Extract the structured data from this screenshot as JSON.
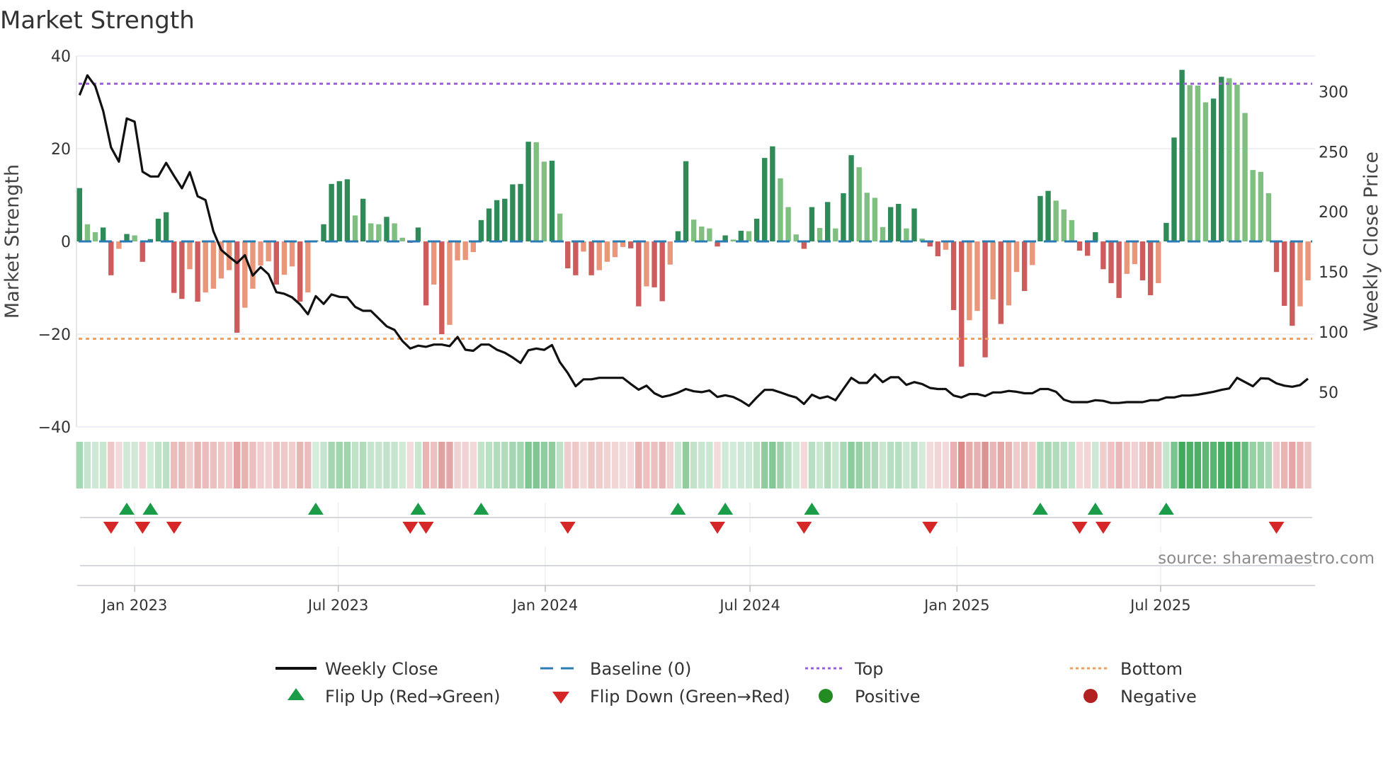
{
  "title": "Market Strength",
  "source": "source: sharemaestro.com",
  "colors": {
    "bar_pos_rising": "#2e8b57",
    "bar_pos_falling": "#7fbf7f",
    "bar_neg_falling": "#cd5c5c",
    "bar_neg_rising": "#e9967a",
    "weekly_close": "#111111",
    "baseline": "#2b7bb4",
    "top": "#9b5fe0",
    "bottom": "#f0a060",
    "flip_up": "#1a9c48",
    "flip_down": "#d62728",
    "positive": "#228b22",
    "negative": "#b22222",
    "strip_green": "#2ca04a",
    "strip_red": "#cd5c5c"
  },
  "legend": [
    {
      "label": "Weekly Close",
      "symbol": "solid-line"
    },
    {
      "label": "Baseline (0)",
      "symbol": "dashed-line"
    },
    {
      "label": "Top",
      "symbol": "dotted-line-purple"
    },
    {
      "label": "Bottom",
      "symbol": "dotted-line-orange"
    },
    {
      "label": "Flip Up (Red→Green)",
      "symbol": "triangle-up"
    },
    {
      "label": "Flip Down (Green→Red)",
      "symbol": "triangle-down"
    },
    {
      "label": "Positive",
      "symbol": "circle-green"
    },
    {
      "label": "Negative",
      "symbol": "circle-red"
    }
  ],
  "chart_data": {
    "type": "bar",
    "title": "Market Strength",
    "ylabel_left": "Market Strength",
    "ylabel_right": "Weekly Close Price",
    "ylim_left": [
      -40,
      40
    ],
    "yticks_left": [
      {
        "value": 40,
        "label": "40"
      },
      {
        "value": 20,
        "label": "20"
      },
      {
        "value": 0,
        "label": "0"
      },
      {
        "value": -20,
        "label": "−20"
      },
      {
        "value": -40,
        "label": "−40"
      }
    ],
    "ylim_right": [
      21.1,
      329.7
    ],
    "yticks_right": [
      {
        "value": 50,
        "label": "50"
      },
      {
        "value": 100,
        "label": "100"
      },
      {
        "value": 150,
        "label": "150"
      },
      {
        "value": 200,
        "label": "200"
      },
      {
        "value": 250,
        "label": "250"
      },
      {
        "value": 300,
        "label": "300"
      }
    ],
    "xticks": [
      {
        "date": "2023-01-01",
        "label": "Jan 2023"
      },
      {
        "date": "2023-07-01",
        "label": "Jul 2023"
      },
      {
        "date": "2024-01-01",
        "label": "Jan 2024"
      },
      {
        "date": "2024-07-01",
        "label": "Jul 2024"
      },
      {
        "date": "2025-01-01",
        "label": "Jan 2025"
      },
      {
        "date": "2025-07-01",
        "label": "Jul 2025"
      }
    ],
    "top": 34,
    "bottom": -21,
    "baseline": 0,
    "grid": true,
    "legend_position": "bottom",
    "dates": [
      "2022-11-13",
      "2022-11-20",
      "2022-11-27",
      "2022-12-04",
      "2022-12-11",
      "2022-12-18",
      "2022-12-25",
      "2023-01-01",
      "2023-01-08",
      "2023-01-15",
      "2023-01-22",
      "2023-01-29",
      "2023-02-05",
      "2023-02-12",
      "2023-02-19",
      "2023-02-26",
      "2023-03-05",
      "2023-03-12",
      "2023-03-19",
      "2023-03-26",
      "2023-04-02",
      "2023-04-09",
      "2023-04-16",
      "2023-04-23",
      "2023-04-30",
      "2023-05-07",
      "2023-05-14",
      "2023-05-21",
      "2023-05-28",
      "2023-06-04",
      "2023-06-11",
      "2023-06-18",
      "2023-06-25",
      "2023-07-02",
      "2023-07-09",
      "2023-07-16",
      "2023-07-23",
      "2023-07-30",
      "2023-08-06",
      "2023-08-13",
      "2023-08-20",
      "2023-08-27",
      "2023-09-03",
      "2023-09-10",
      "2023-09-17",
      "2023-09-24",
      "2023-10-01",
      "2023-10-08",
      "2023-10-15",
      "2023-10-22",
      "2023-10-29",
      "2023-11-05",
      "2023-11-12",
      "2023-11-19",
      "2023-11-26",
      "2023-12-03",
      "2023-12-10",
      "2023-12-17",
      "2023-12-24",
      "2023-12-31",
      "2024-01-07",
      "2024-01-14",
      "2024-01-21",
      "2024-01-28",
      "2024-02-04",
      "2024-02-11",
      "2024-02-18",
      "2024-02-25",
      "2024-03-03",
      "2024-03-10",
      "2024-03-17",
      "2024-03-24",
      "2024-03-31",
      "2024-04-07",
      "2024-04-14",
      "2024-04-21",
      "2024-04-28",
      "2024-05-05",
      "2024-05-12",
      "2024-05-19",
      "2024-05-26",
      "2024-06-02",
      "2024-06-09",
      "2024-06-16",
      "2024-06-23",
      "2024-06-30",
      "2024-07-07",
      "2024-07-14",
      "2024-07-21",
      "2024-07-28",
      "2024-08-04",
      "2024-08-11",
      "2024-08-18",
      "2024-08-25",
      "2024-09-01",
      "2024-09-08",
      "2024-09-15",
      "2024-09-22",
      "2024-09-29",
      "2024-10-06",
      "2024-10-13",
      "2024-10-20",
      "2024-10-27",
      "2024-11-03",
      "2024-11-10",
      "2024-11-17",
      "2024-11-24",
      "2024-12-01",
      "2024-12-08",
      "2024-12-15",
      "2024-12-22",
      "2024-12-29",
      "2025-01-05",
      "2025-01-12",
      "2025-01-19",
      "2025-01-26",
      "2025-02-02",
      "2025-02-09",
      "2025-02-16",
      "2025-02-23",
      "2025-03-02",
      "2025-03-09",
      "2025-03-16",
      "2025-03-23",
      "2025-03-30",
      "2025-04-06",
      "2025-04-13",
      "2025-04-20",
      "2025-04-27",
      "2025-05-04",
      "2025-05-11",
      "2025-05-18",
      "2025-05-25",
      "2025-06-01",
      "2025-06-08",
      "2025-06-15",
      "2025-06-22",
      "2025-06-29",
      "2025-07-06",
      "2025-07-13",
      "2025-07-20",
      "2025-07-27",
      "2025-08-03",
      "2025-08-10",
      "2025-08-17",
      "2025-08-24",
      "2025-08-31",
      "2025-09-07",
      "2025-09-14",
      "2025-09-21",
      "2025-09-28",
      "2025-10-05",
      "2025-10-12",
      "2025-10-19",
      "2025-10-26",
      "2025-11-02",
      "2025-11-09"
    ],
    "strength": [
      11.5,
      3.7,
      2,
      3,
      -7.3,
      -1.6,
      1.6,
      1.3,
      -4.4,
      0.5,
      4.9,
      6.3,
      -11.1,
      -12.4,
      -6,
      -13,
      -11,
      -10.2,
      -8,
      -6.2,
      -19.7,
      -14.3,
      -10.2,
      -5.2,
      -4.3,
      -9.3,
      -7.2,
      -5.4,
      -13,
      -11,
      0.2,
      3.7,
      12.4,
      13,
      13.4,
      5.6,
      9.2,
      3.9,
      3.7,
      5.3,
      3.9,
      0.8,
      -0.3,
      3,
      -13.8,
      -9.3,
      -20,
      -18,
      -4.1,
      -4.0,
      -2.3,
      4.6,
      7.1,
      8.9,
      9.2,
      12.3,
      12.4,
      21.5,
      21.4,
      17.2,
      17.4,
      6,
      -5.8,
      -7.3,
      -2.2,
      -7.3,
      -6.2,
      -4.4,
      -3.4,
      -1.2,
      -1.5,
      -14,
      -9.7,
      -9.9,
      -12.9,
      -5,
      2.2,
      17.3,
      4.7,
      3.2,
      2.8,
      -1.1,
      1.3,
      0.4,
      2.3,
      2.2,
      4.9,
      18,
      20.5,
      13.6,
      7.4,
      1.5,
      -1.6,
      7.4,
      2.9,
      8.5,
      2.8,
      10.4,
      18.6,
      16,
      10.5,
      9.4,
      3.1,
      7.4,
      8.1,
      2.8,
      7.1,
      0.6,
      -1.1,
      -3.2,
      -1.8,
      -14.8,
      -27,
      -17,
      -15,
      -25,
      -12.5,
      -17.8,
      -13.8,
      -6.6,
      -10.7,
      -5.1,
      9.8,
      10.9,
      8.8,
      6.9,
      4.6,
      -2,
      -3.1,
      2,
      -6,
      -9,
      -12.2,
      -7,
      -4.9,
      -8.4,
      -11.6,
      -9,
      4,
      22.4,
      37,
      33.7,
      33.6,
      30,
      30.8,
      35.5,
      35.2,
      33.8,
      27.7,
      15.4,
      15,
      10.4,
      -6.6,
      -13.9,
      -18.2,
      -14,
      -8.4
    ],
    "weekly_close": [
      297,
      313.5,
      304.6,
      284,
      253.6,
      241.8,
      277.7,
      275,
      233.4,
      229.4,
      229.4,
      240.8,
      230,
      219.6,
      233,
      213,
      209.8,
      183.9,
      168.2,
      162.7,
      157.4,
      163.9,
      147,
      154,
      148,
      133.2,
      131.9,
      128.9,
      123,
      114.8,
      129.9,
      123.4,
      131.3,
      129.3,
      128.9,
      121,
      117.7,
      117.7,
      111.2,
      104.8,
      101.8,
      92.6,
      86.3,
      88.7,
      87.7,
      89.6,
      89.6,
      88.3,
      95.9,
      85.3,
      84.4,
      89.6,
      89.6,
      85.3,
      82.8,
      78.9,
      74.3,
      84.8,
      86.3,
      85.2,
      89.2,
      74.9,
      66,
      54.9,
      60.7,
      60.7,
      61.9,
      61.9,
      61.9,
      61.9,
      56.8,
      52.1,
      55.4,
      49.1,
      46,
      47.4,
      49.6,
      52.6,
      50.7,
      50,
      51.4,
      46,
      47.4,
      46,
      42.8,
      38.6,
      45.6,
      51.9,
      51.9,
      49.8,
      47.4,
      45.6,
      40.2,
      47.9,
      44.9,
      46.5,
      43.3,
      52.6,
      61.9,
      57.7,
      57.7,
      64.7,
      58.4,
      62.4,
      62.4,
      56.1,
      58.4,
      56.8,
      53.5,
      52.6,
      52.6,
      47.2,
      45.6,
      48.4,
      48.4,
      46.8,
      49.8,
      49.8,
      51,
      50.3,
      49.1,
      49.1,
      52.6,
      52.6,
      50.3,
      43.8,
      41.7,
      41.7,
      41.7,
      43.3,
      42.8,
      41,
      41,
      41.7,
      41.7,
      41.7,
      43.3,
      43.3,
      45.6,
      45.6,
      47.2,
      47.2,
      47.9,
      49.1,
      50.3,
      51.9,
      53.1,
      61.9,
      58.4,
      54.9,
      61.5,
      61.2,
      57.3,
      55.4,
      54.5,
      55.9,
      61.2
    ]
  }
}
